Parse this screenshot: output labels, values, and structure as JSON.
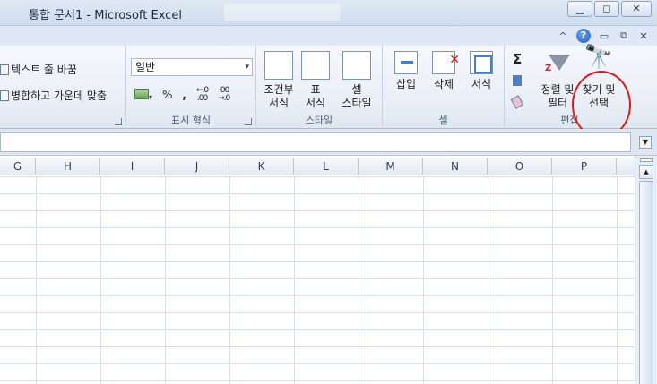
{
  "window": {
    "title": "통합 문서1  -  Microsoft Excel",
    "minimize": "▁",
    "restore": "◻",
    "close": "✕"
  },
  "helpbar": {
    "chevron": "^",
    "help": "?",
    "min": "▭",
    "restore": "⧉",
    "close": "✕"
  },
  "ribbon": {
    "alignment": {
      "wrap_text": "텍스트 줄 바꿈",
      "merge_center": "병합하고 가운데 맞춤",
      "dropdown": "▾"
    },
    "number": {
      "format_value": "일반",
      "percent": "%",
      "comma": ",",
      "increase_decimal": "←.0\n.00",
      "decrease_decimal": ".00\n→.0",
      "label": "표시 형식"
    },
    "styles": {
      "conditional_line1": "조건부",
      "conditional_line2": "서식",
      "table_line1": "표",
      "table_line2": "서식",
      "cell_line1": "셀",
      "cell_line2": "스타일",
      "label": "스타일"
    },
    "cells": {
      "insert": "삽입",
      "delete": "삭제",
      "format": "서식",
      "label": "셀"
    },
    "editing": {
      "sigma": "Σ",
      "sort_line1": "정렬 및",
      "sort_line2": "필터",
      "find_line1": "찾기 및",
      "find_line2": "선택",
      "label": "편집"
    }
  },
  "grid": {
    "columns": [
      "G",
      "H",
      "I",
      "J",
      "K",
      "L",
      "M",
      "N",
      "O",
      "P"
    ]
  },
  "accent_colors": {
    "highlight": "#e01818",
    "ribbon": "#e9eef6"
  }
}
